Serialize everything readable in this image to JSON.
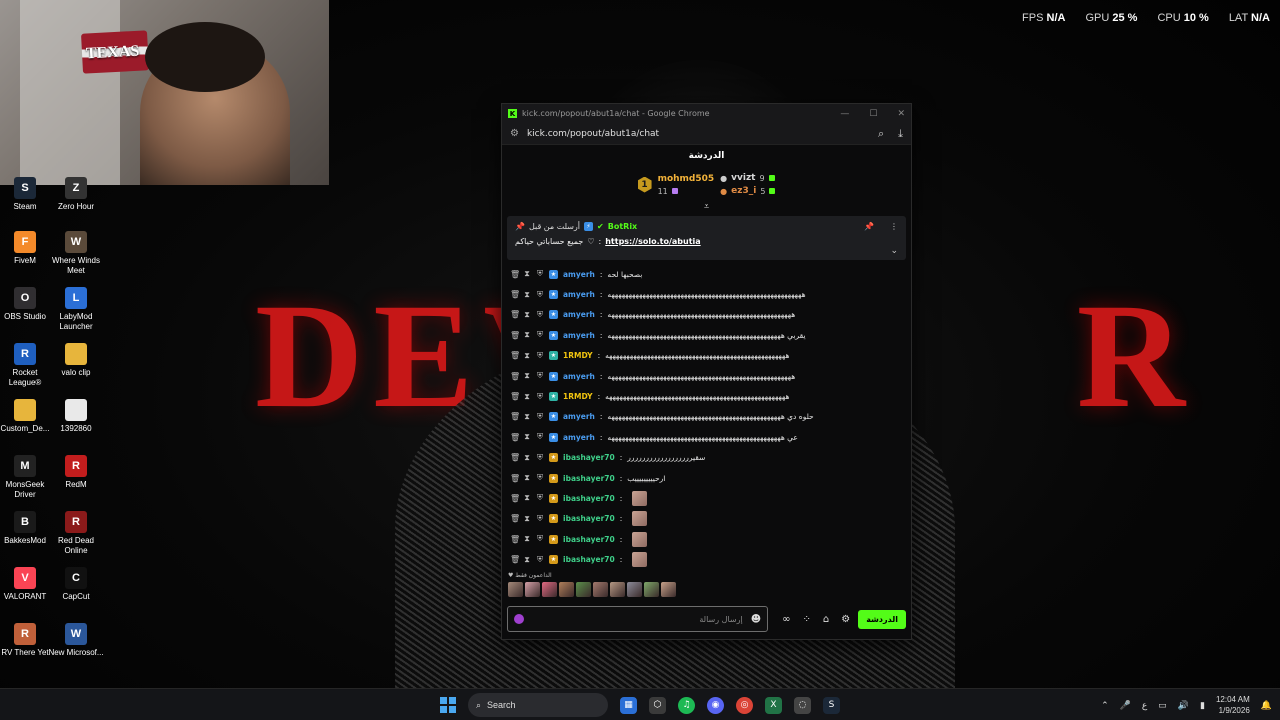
{
  "perf": [
    {
      "label": "FPS",
      "value": "N/A"
    },
    {
      "label": "GPU",
      "value": "25 %"
    },
    {
      "label": "CPU",
      "value": "10 %"
    },
    {
      "label": "LAT",
      "value": "N/A"
    }
  ],
  "webcam": {
    "flag_text": "TEXAS"
  },
  "desktop_icons": [
    {
      "label": "Steam",
      "icon": "steam-icon",
      "color": "#1b2838",
      "glyph": "S"
    },
    {
      "label": "Zero Hour",
      "icon": "zero-hour-icon",
      "color": "#333333",
      "glyph": "Z"
    },
    {
      "label": "FiveM",
      "icon": "fivem-icon",
      "color": "#f48a2a",
      "glyph": "F"
    },
    {
      "label": "Where Winds Meet",
      "icon": "where-winds-meet-icon",
      "color": "#5a4a3a",
      "glyph": "W"
    },
    {
      "label": "OBS Studio",
      "icon": "obs-icon",
      "color": "#302e31",
      "glyph": "O"
    },
    {
      "label": "LabyMod Launcher",
      "icon": "labymod-icon",
      "color": "#2b6fd6",
      "glyph": "L"
    },
    {
      "label": "Rocket League®",
      "icon": "rocket-league-icon",
      "color": "#1f5fbf",
      "glyph": "R"
    },
    {
      "label": "valo clip",
      "icon": "folder-icon",
      "color": "#e7b53c",
      "glyph": ""
    },
    {
      "label": "Custom_De...",
      "icon": "folder-icon",
      "color": "#e7b53c",
      "glyph": ""
    },
    {
      "label": "1392860",
      "icon": "file-icon",
      "color": "#e9e9e9",
      "glyph": ""
    },
    {
      "label": "MonsGeek Driver",
      "icon": "monsgeek-icon",
      "color": "#222222",
      "glyph": "M"
    },
    {
      "label": "RedM",
      "icon": "redm-icon",
      "color": "#c21d1d",
      "glyph": "R"
    },
    {
      "label": "BakkesMod",
      "icon": "bakkesmod-icon",
      "color": "#1a1a1a",
      "glyph": "B"
    },
    {
      "label": "Red Dead Online",
      "icon": "red-dead-online-icon",
      "color": "#8b1a1a",
      "glyph": "R"
    },
    {
      "label": "VALORANT",
      "icon": "valorant-icon",
      "color": "#fa4454",
      "glyph": "V"
    },
    {
      "label": "CapCut",
      "icon": "capcut-icon",
      "color": "#111111",
      "glyph": "C"
    },
    {
      "label": "RV There Yet",
      "icon": "rv-there-yet-icon",
      "color": "#c0603a",
      "glyph": "R"
    },
    {
      "label": "New Microsof...",
      "icon": "word-icon",
      "color": "#2b579a",
      "glyph": "W"
    }
  ],
  "window": {
    "title": "kick.com/popout/abut1a/chat - Google Chrome",
    "url": "kick.com/popout/abut1a/chat",
    "chat_title": "الدردشة",
    "leaders": {
      "first": {
        "rank": "1",
        "name": "mohmd505",
        "count": "11"
      },
      "second": {
        "name": "vvizt",
        "count": "9"
      },
      "third": {
        "name": "ez3_i",
        "count": "5"
      }
    },
    "pinned": {
      "label": "أرسلت من قبل",
      "bot": "BotRix",
      "text": "جميع حساباتي حياكم",
      "link": "https://solo.to/abutia"
    },
    "messages": [
      {
        "user": "amyerh",
        "color": "#4a9cf0",
        "badge": "blue",
        "text": "بصحبها لحه",
        "emotes": 0
      },
      {
        "user": "amyerh",
        "color": "#4a9cf0",
        "badge": "blue",
        "text": "ههههههههههههههههههههههههههههههههههههههههههههههههههههههههه",
        "emotes": 0
      },
      {
        "user": "amyerh",
        "color": "#4a9cf0",
        "badge": "blue",
        "text": "هههههههههههههههههههههههههههههههههههههههههههههههههههههه",
        "emotes": 0
      },
      {
        "user": "amyerh",
        "color": "#4a9cf0",
        "badge": "blue",
        "text": "يقربي ههههههههههههههههههههههههههههههههههههههههههههههههههه",
        "emotes": 0
      },
      {
        "user": "1RMDY",
        "color": "#f1c40f",
        "badge": "teal",
        "text": "ههههههههههههههههههههههههههههههههههههههههههههههههههههه",
        "emotes": 0
      },
      {
        "user": "amyerh",
        "color": "#4a9cf0",
        "badge": "blue",
        "text": "هههههههههههههههههههههههههههههههههههههههههههههههههههههه",
        "emotes": 0
      },
      {
        "user": "1RMDY",
        "color": "#f1c40f",
        "badge": "teal",
        "text": "ههههههههههههههههههههههههههههههههههههههههههههههههههههه",
        "emotes": 0
      },
      {
        "user": "amyerh",
        "color": "#4a9cf0",
        "badge": "blue",
        "text": "حلوه دي ههههههههههههههههههههههههههههههههههههههههههههههههههه",
        "emotes": 0
      },
      {
        "user": "amyerh",
        "color": "#4a9cf0",
        "badge": "blue",
        "text": "عي ههههههههههههههههههههههههههههههههههههههههههههههههههه",
        "emotes": 0
      },
      {
        "user": "ibashayer70",
        "color": "#3fd08a",
        "badge": "gold",
        "text": "سقيرررررررررررررررررر",
        "emotes": 0
      },
      {
        "user": "ibashayer70",
        "color": "#3fd08a",
        "badge": "gold",
        "text": "ارحيييييييييب",
        "emotes": 0
      },
      {
        "user": "ibashayer70",
        "color": "#3fd08a",
        "badge": "gold",
        "text": "",
        "emotes": 1
      },
      {
        "user": "ibashayer70",
        "color": "#3fd08a",
        "badge": "gold",
        "text": "",
        "emotes": 1
      },
      {
        "user": "ibashayer70",
        "color": "#3fd08a",
        "badge": "gold",
        "text": "",
        "emotes": 1
      },
      {
        "user": "ibashayer70",
        "color": "#3fd08a",
        "badge": "gold",
        "text": "",
        "emotes": 1
      }
    ],
    "supporters_label": "الداعمون فقط",
    "supporter_emote_colors": [
      "#a58a7a",
      "#d5a1a8",
      "#e26a83",
      "#b07f5a",
      "#5a8f4a",
      "#a47a6e",
      "#b59884",
      "#8c8c9a",
      "#7fa86a",
      "#c7a18a"
    ],
    "input_placeholder": "إرسال رسالة",
    "send_label": "الدردشة"
  },
  "taskbar": {
    "search_label": "Search",
    "lang": "ع",
    "time": "12:04 AM",
    "date": "1/9/2026"
  }
}
